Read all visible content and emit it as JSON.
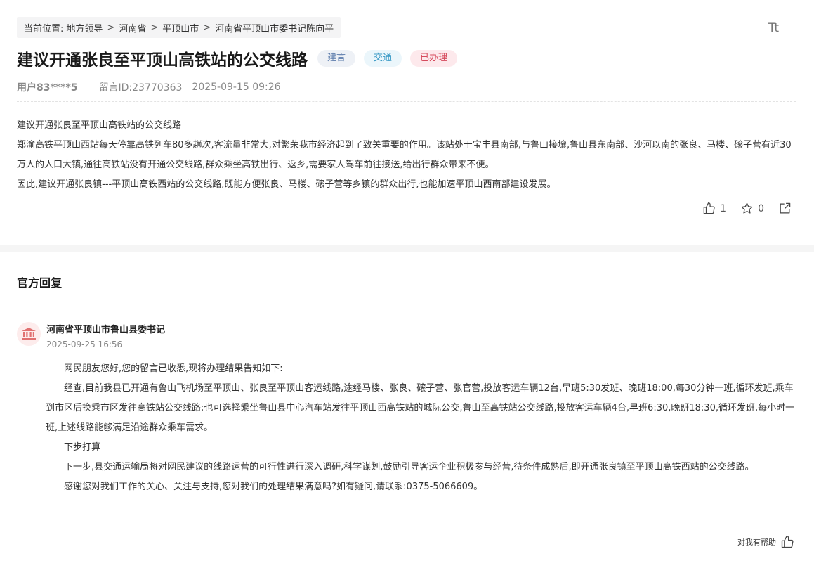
{
  "breadcrumb": {
    "prefix": "当前位置:",
    "items": [
      "地方领导",
      "河南省",
      "平顶山市",
      "河南省平顶山市委书记陈向平"
    ]
  },
  "font_toggle": "Tt",
  "post": {
    "title": "建议开通张良至平顶山高铁站的公交线路",
    "tags": [
      "建言",
      "交通",
      "已办理"
    ],
    "user": "用户83****5",
    "message_id": "留言ID:23770363",
    "datetime": "2025-09-15 09:26",
    "paragraphs": [
      "建议开通张良至平顶山高铁站的公交线路",
      "郑渝高铁平顶山西站每天停靠高铁列车80多趟次,客流量非常大,对繁荣我市经济起到了致关重要的作用。该站处于宝丰县南部,与鲁山接壤,鲁山县东南部、沙河以南的张良、马楼、磙子营有近30万人的人口大镇,通往高铁站没有开通公交线路,群众乘坐高铁出行、返乡,需要家人驾车前往接送,给出行群众带来不便。",
      "因此,建议开通张良镇---平顶山高铁西站的公交线路,既能方便张良、马楼、磙子营等乡镇的群众出行,也能加速平顶山西南部建设发展。"
    ],
    "likes": "1",
    "favorites": "0"
  },
  "reply": {
    "heading": "官方回复",
    "org_name": "河南省平顶山市鲁山县委书记",
    "date": "2025-09-25 16:56",
    "paragraphs": [
      "网民朋友您好,您的留言已收悉,现将办理结果告知如下:",
      "经查,目前我县已开通有鲁山飞机场至平顶山、张良至平顶山客运线路,途经马楼、张良、磙子营、张官营,投放客运车辆12台,早班5:30发班、晚班18:00,每30分钟一班,循环发班,乘车到市区后换乘市区发往高铁站公交线路;也可选择乘坐鲁山县中心汽车站发往平顶山西高铁站的城际公交,鲁山至高铁站公交线路,投放客运车辆4台,早班6:30,晚班18:30,循环发班,每小时一班,上述线路能够满足沿途群众乘车需求。",
      "下步打算",
      "下一步,县交通运输局将对网民建议的线路运营的可行性进行深入调研,科学谋划,鼓励引导客运企业积极参与经营,待条件成熟后,即开通张良镇至平顶山高铁西站的公交线路。",
      "感谢您对我们工作的关心、关注与支持,您对我们的处理结果满意吗?如有疑问,请联系:0375-5066609。"
    ],
    "helpful_label": "对我有帮助"
  },
  "colors": {
    "tag_suggest": "#5b7bab",
    "tag_traffic": "#3b9ac6",
    "tag_done": "#d64b5d",
    "org_logo": "#e07070"
  }
}
